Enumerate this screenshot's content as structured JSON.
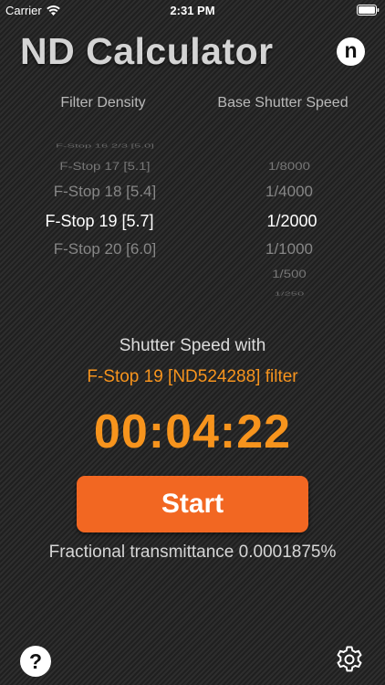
{
  "status_bar": {
    "carrier": "Carrier",
    "time": "2:31 PM"
  },
  "header": {
    "title": "ND Calculator",
    "badge": "n"
  },
  "picker": {
    "left_header": "Filter Density",
    "right_header": "Base Shutter Speed",
    "filter_density": [
      "F-Stop 16 2/3 [5.0]",
      "F-Stop 17 [5.1]",
      "F-Stop 18 [5.4]",
      "F-Stop 19 [5.7]",
      "F-Stop 20 [6.0]"
    ],
    "filter_selected_index": 3,
    "base_shutter_speed": [
      "1/8000",
      "1/4000",
      "1/2000",
      "1/1000",
      "1/500",
      "1/250"
    ],
    "shutter_selected_index": 2
  },
  "result": {
    "label": "Shutter Speed with",
    "filter": "F-Stop 19 [ND524288] filter",
    "time": "00:04:22"
  },
  "start_button": {
    "label": "Start"
  },
  "transmittance": "Fractional transmittance 0.0001875%",
  "footer": {
    "help": "?"
  },
  "colors": {
    "accent": "#f7941d",
    "button": "#f26722"
  }
}
